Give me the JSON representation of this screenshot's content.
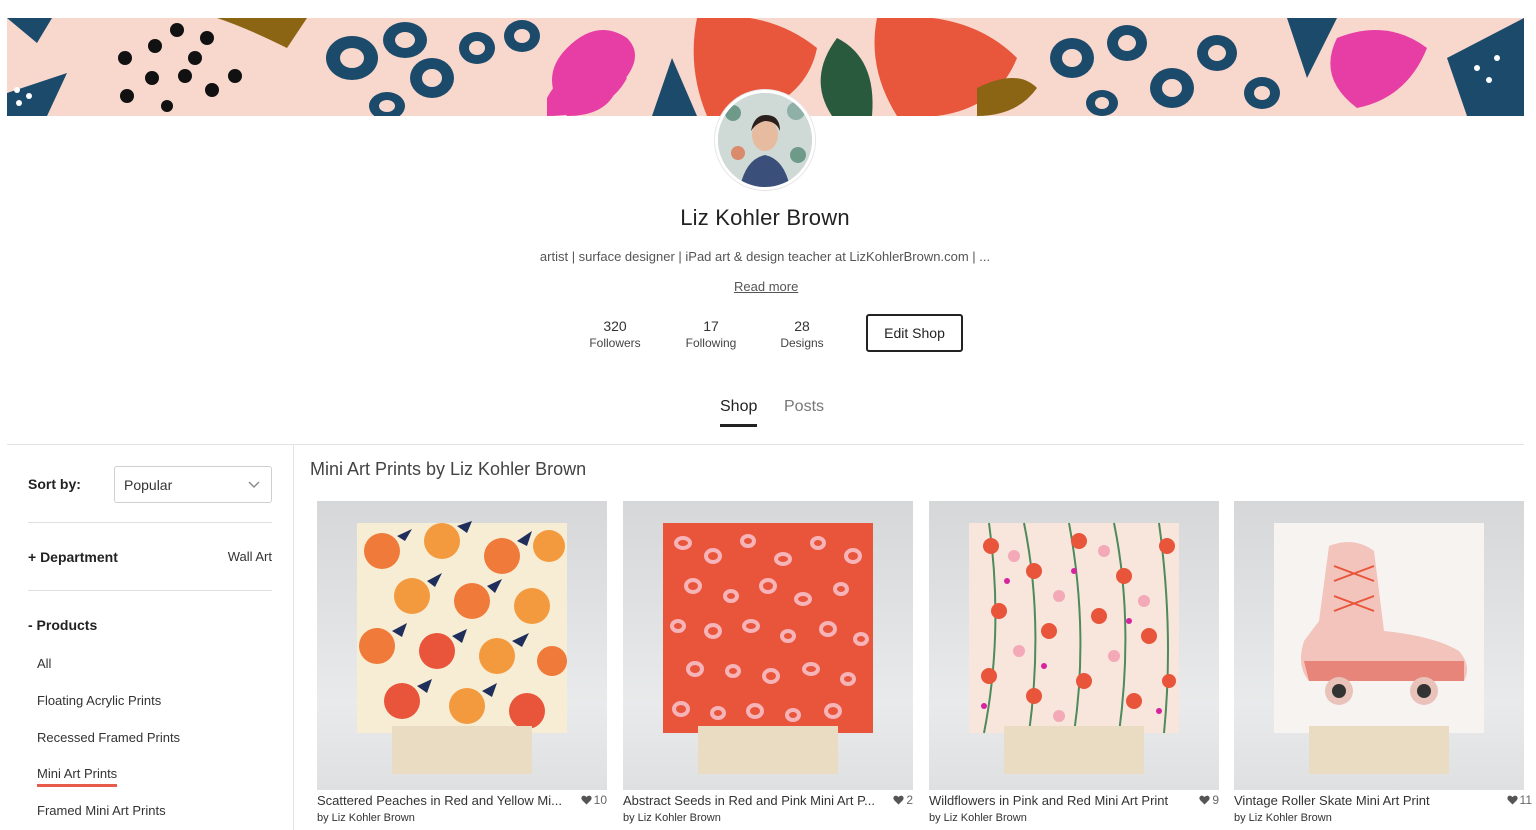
{
  "profile": {
    "name": "Liz Kohler Brown",
    "bio": "artist | surface designer | iPad art & design teacher at LizKohlerBrown.com | ...",
    "read_more": "Read more",
    "edit_shop": "Edit Shop"
  },
  "stats": [
    {
      "num": "320",
      "label": "Followers"
    },
    {
      "num": "17",
      "label": "Following"
    },
    {
      "num": "28",
      "label": "Designs"
    }
  ],
  "tabs": [
    {
      "label": "Shop",
      "active": true
    },
    {
      "label": "Posts",
      "active": false
    }
  ],
  "sidebar": {
    "sort_label": "Sort by:",
    "sort_value": "Popular",
    "department_label": "+ Department",
    "department_value": "Wall Art",
    "products_label": "- Products",
    "products": [
      "All",
      "Floating Acrylic Prints",
      "Recessed Framed Prints",
      "Mini Art Prints",
      "Framed Mini Art Prints"
    ],
    "active_product": "Mini Art Prints"
  },
  "main": {
    "section_title": "Mini Art Prints by Liz Kohler Brown",
    "cards": [
      {
        "title": "Scattered Peaches in Red and Yellow Mi...",
        "likes": "10",
        "by": "by Liz Kohler Brown"
      },
      {
        "title": "Abstract Seeds in Red and Pink Mini Art P...",
        "likes": "2",
        "by": "by Liz Kohler Brown"
      },
      {
        "title": "Wildflowers in Pink and Red Mini Art Print",
        "likes": "9",
        "by": "by Liz Kohler Brown"
      },
      {
        "title": "Vintage Roller Skate Mini Art Print",
        "likes": "11",
        "by": "by Liz Kohler Brown"
      }
    ]
  },
  "colors": {
    "banner_bg": "#f8d7cd",
    "accent_underline": "#e85a4a"
  }
}
